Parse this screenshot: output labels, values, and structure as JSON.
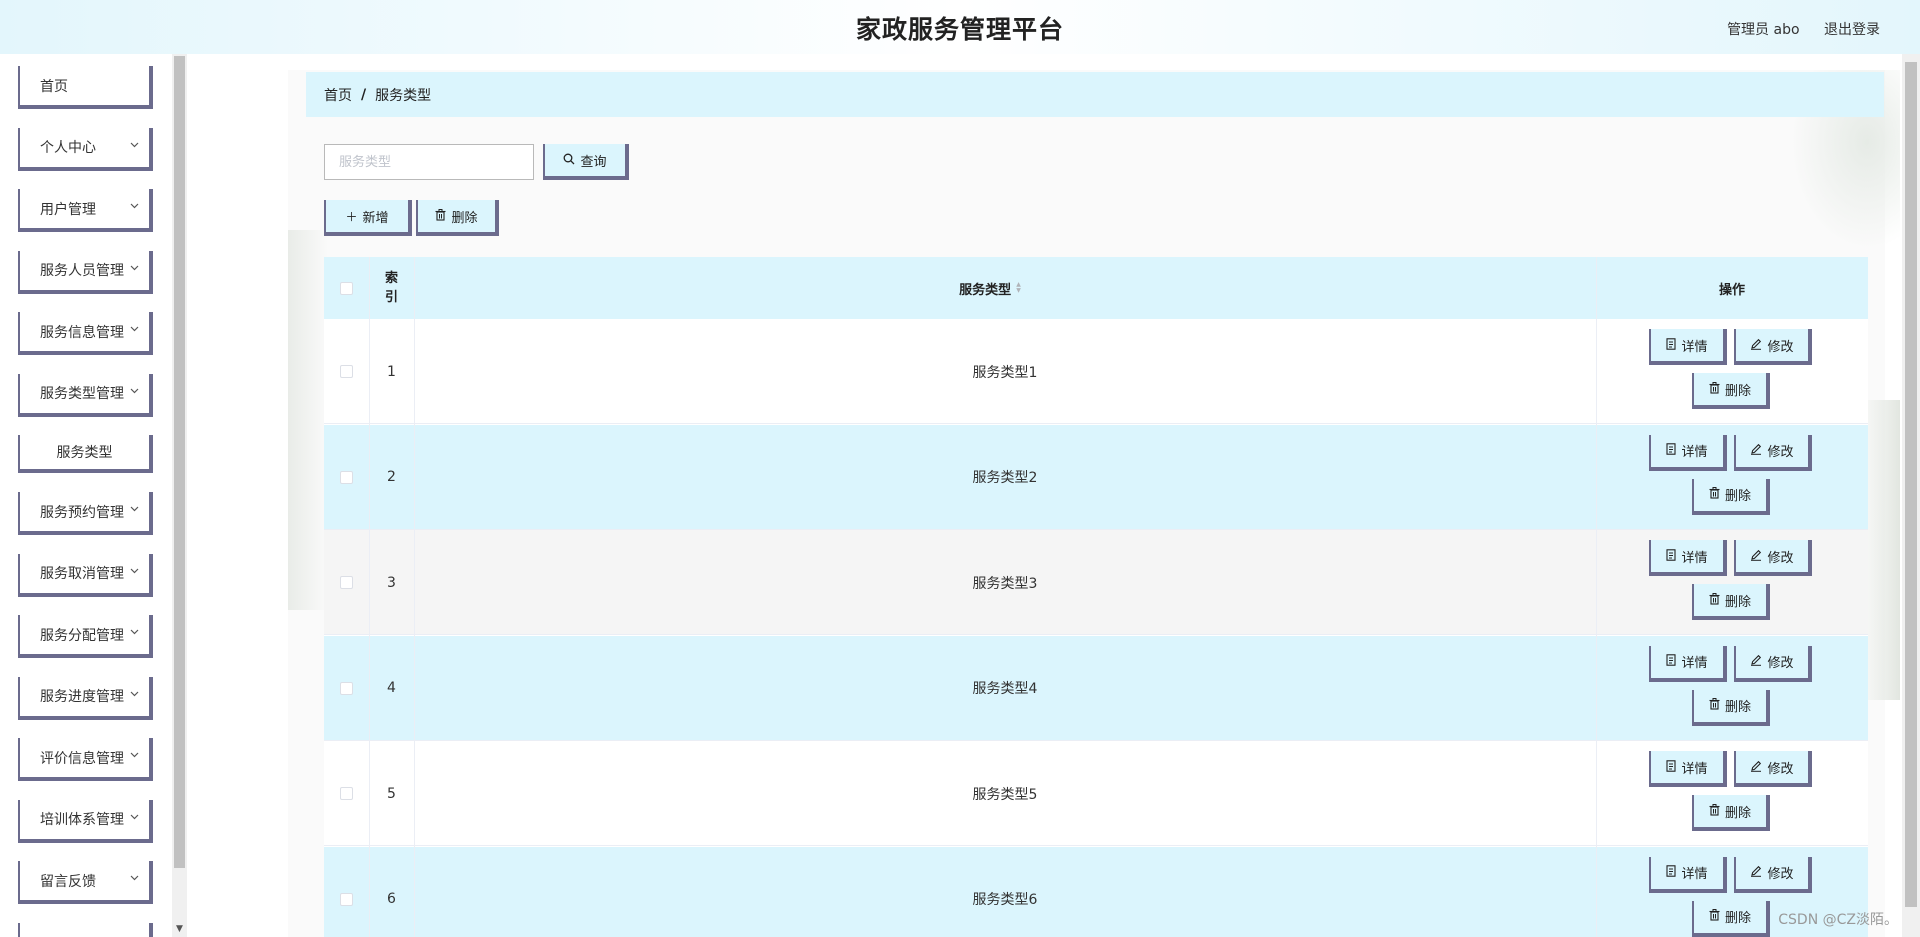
{
  "header": {
    "title": "家政服务管理平台",
    "user": "管理员 abo",
    "logout": "退出登录"
  },
  "sidebar": {
    "items": [
      {
        "label": "首页",
        "expandable": false
      },
      {
        "label": "个人中心",
        "expandable": true
      },
      {
        "label": "用户管理",
        "expandable": true
      },
      {
        "label": "服务人员管理",
        "expandable": true
      },
      {
        "label": "服务信息管理",
        "expandable": true
      },
      {
        "label": "服务类型管理",
        "expandable": true
      },
      {
        "label": "服务类型",
        "expandable": false,
        "sub": true
      },
      {
        "label": "服务预约管理",
        "expandable": true
      },
      {
        "label": "服务取消管理",
        "expandable": true
      },
      {
        "label": "服务分配管理",
        "expandable": true
      },
      {
        "label": "服务进度管理",
        "expandable": true
      },
      {
        "label": "评价信息管理",
        "expandable": true
      },
      {
        "label": "培训体系管理",
        "expandable": true
      },
      {
        "label": "留言反馈",
        "expandable": true
      }
    ]
  },
  "breadcrumb": {
    "home": "首页",
    "sep": "/",
    "current": "服务类型"
  },
  "search": {
    "placeholder": "服务类型",
    "value": "",
    "button": "查询"
  },
  "toolbar": {
    "add": "新增",
    "delete": "删除"
  },
  "table": {
    "headers": {
      "index": "索引",
      "type": "服务类型",
      "actions": "操作"
    },
    "rows": [
      {
        "index": "1",
        "type": "服务类型1"
      },
      {
        "index": "2",
        "type": "服务类型2"
      },
      {
        "index": "3",
        "type": "服务类型3"
      },
      {
        "index": "4",
        "type": "服务类型4"
      },
      {
        "index": "5",
        "type": "服务类型5"
      },
      {
        "index": "6",
        "type": "服务类型6"
      }
    ],
    "actions": {
      "detail": "详情",
      "edit": "修改",
      "delete": "删除"
    }
  },
  "watermark": "CSDN @CZ淡陌。",
  "colors": {
    "accent_bg": "#dbf5fd",
    "button_border": "#6b6b8d",
    "stripe_gray": "#f5f5f5"
  }
}
